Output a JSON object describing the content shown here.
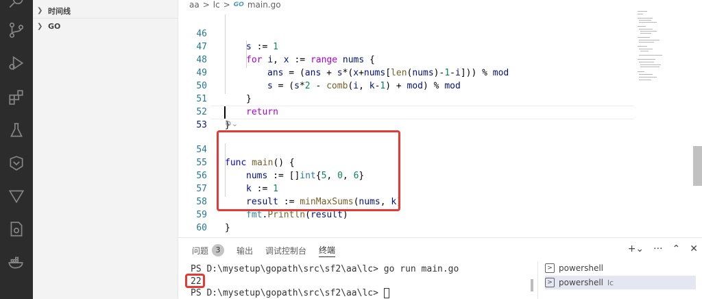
{
  "sidebar": {
    "items": [
      {
        "label": "时间线"
      },
      {
        "label": "GO"
      }
    ]
  },
  "breadcrumb": [
    "aa",
    "lc",
    "main.go"
  ],
  "breadcrumb_icon": "GO",
  "code": {
    "lines": [
      {
        "n": "46"
      },
      {
        "n": "47"
      },
      {
        "n": "48"
      },
      {
        "n": "49"
      },
      {
        "n": "50"
      },
      {
        "n": "51"
      },
      {
        "n": "52"
      },
      {
        "n": "53"
      },
      {
        "n": "54"
      },
      {
        "n": "55"
      },
      {
        "n": "56"
      },
      {
        "n": "57"
      },
      {
        "n": "58"
      },
      {
        "n": "59"
      },
      {
        "n": "60"
      }
    ]
  },
  "panel": {
    "tabs": [
      "问题",
      "输出",
      "调试控制台",
      "终端"
    ],
    "problems_count": "3",
    "terminal": {
      "prompt1": "PS D:\\mysetup\\gopath\\src\\sf2\\aa\\lc> ",
      "cmd1": "go run main.go",
      "output": "22",
      "prompt2": "PS D:\\mysetup\\gopath\\src\\sf2\\aa\\lc> "
    },
    "terminal_list": [
      {
        "name": "powershell",
        "sub": ""
      },
      {
        "name": "powershell",
        "sub": "lc"
      }
    ]
  },
  "colors": {
    "highlight_box": "#e53935",
    "activity_bar": "#2c2c2c"
  }
}
